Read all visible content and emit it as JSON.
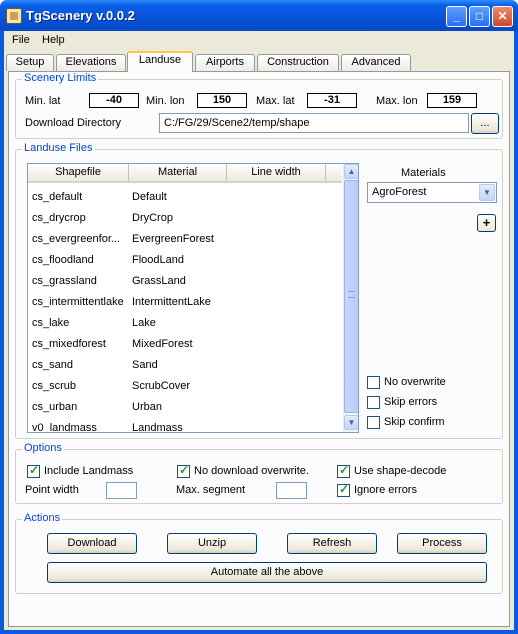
{
  "window": {
    "title": "TgScenery v.0.0.2"
  },
  "menu": [
    "File",
    "Help"
  ],
  "tabs": [
    "Setup",
    "Elevations",
    "Landuse",
    "Airports",
    "Construction",
    "Advanced"
  ],
  "scenery_limits": {
    "title": "Scenery Limits",
    "min_lat_label": "Min. lat",
    "min_lat": "-40",
    "min_lon_label": "Min. lon",
    "min_lon": "150",
    "max_lat_label": "Max. lat",
    "max_lat": "-31",
    "max_lon_label": "Max. lon",
    "max_lon": "159",
    "download_dir_label": "Download Directory",
    "download_dir": "C:/FG/29/Scene2/temp/shape",
    "browse_label": "..."
  },
  "landuse_files": {
    "title": "Landuse Files",
    "columns": [
      "Shapefile",
      "Material",
      "Line width"
    ],
    "rows": [
      {
        "shapefile": "cs_default",
        "material": "Default"
      },
      {
        "shapefile": "cs_drycrop",
        "material": "DryCrop"
      },
      {
        "shapefile": "cs_evergreenfor...",
        "material": "EvergreenForest"
      },
      {
        "shapefile": "cs_floodland",
        "material": "FloodLand"
      },
      {
        "shapefile": "cs_grassland",
        "material": "GrassLand"
      },
      {
        "shapefile": "cs_intermittentlake",
        "material": "IntermittentLake"
      },
      {
        "shapefile": "cs_lake",
        "material": "Lake"
      },
      {
        "shapefile": "cs_mixedforest",
        "material": "MixedForest"
      },
      {
        "shapefile": "cs_sand",
        "material": "Sand"
      },
      {
        "shapefile": "cs_scrub",
        "material": "ScrubCover"
      },
      {
        "shapefile": "cs_urban",
        "material": "Urban"
      },
      {
        "shapefile": "v0_landmass",
        "material": "Landmass"
      }
    ],
    "materials_label": "Materials",
    "materials_selected": "AgroForest",
    "add_label": "+",
    "checks": [
      {
        "label": "No overwrite",
        "checked": false
      },
      {
        "label": "Skip errors",
        "checked": false
      },
      {
        "label": "Skip confirm",
        "checked": false
      }
    ]
  },
  "options": {
    "title": "Options",
    "include_landmass": {
      "label": "Include Landmass",
      "checked": true
    },
    "no_download_overwrite": {
      "label": "No download overwrite.",
      "checked": true
    },
    "use_shape_decode": {
      "label": "Use shape-decode",
      "checked": true
    },
    "ignore_errors": {
      "label": "Ignore errors",
      "checked": true
    },
    "point_width_label": "Point width",
    "point_width": "",
    "max_segment_label": "Max. segment",
    "max_segment": ""
  },
  "actions": {
    "title": "Actions",
    "download": "Download",
    "unzip": "Unzip",
    "refresh": "Refresh",
    "process": "Process",
    "automate": "Automate all the above"
  }
}
